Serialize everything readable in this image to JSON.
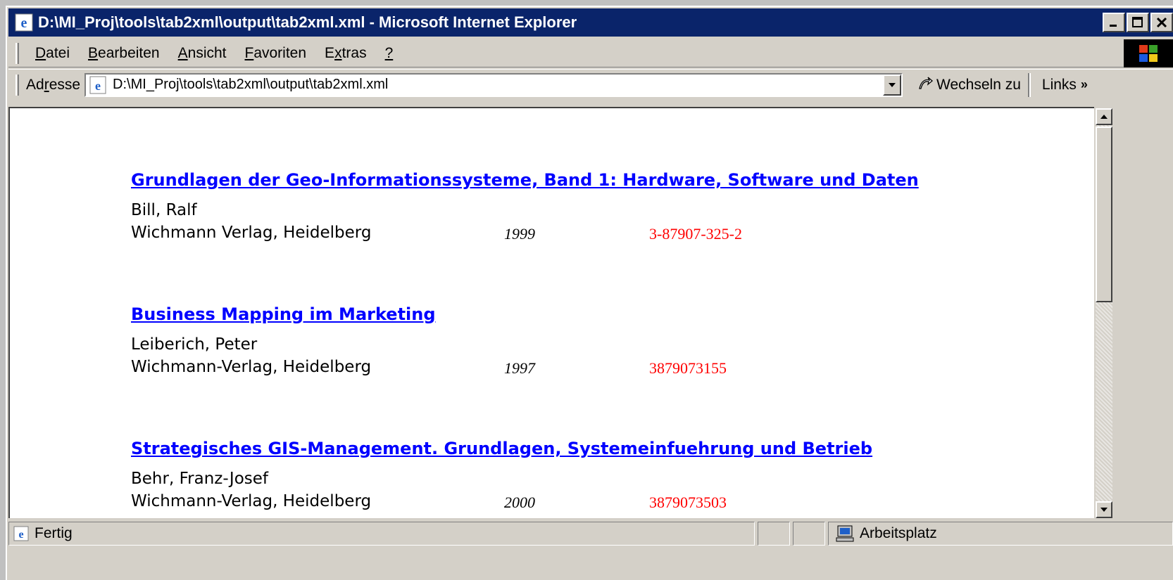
{
  "window": {
    "title": "D:\\MI_Proj\\tools\\tab2xml\\output\\tab2xml.xml - Microsoft Internet Explorer",
    "icon": "ie-icon"
  },
  "menu": {
    "items": [
      {
        "pre": "",
        "key": "D",
        "post": "atei"
      },
      {
        "pre": "",
        "key": "B",
        "post": "earbeiten"
      },
      {
        "pre": "",
        "key": "A",
        "post": "nsicht"
      },
      {
        "pre": "",
        "key": "F",
        "post": "avoriten"
      },
      {
        "pre": "E",
        "key": "x",
        "post": "tras"
      },
      {
        "pre": "",
        "key": "?",
        "post": ""
      }
    ]
  },
  "address": {
    "label_pre": "Ad",
    "label_key": "r",
    "label_post": "esse",
    "value": "D:\\MI_Proj\\tools\\tab2xml\\output\\tab2xml.xml",
    "go_label": "Wechseln zu",
    "links_label": "Links"
  },
  "entries": [
    {
      "title": "Grundlagen der Geo-Informationssysteme, Band 1: Hardware, Software und Daten",
      "author": "Bill, Ralf",
      "publisher": "Wichmann Verlag, Heidelberg",
      "year": "1999",
      "isbn": "3-87907-325-2"
    },
    {
      "title": "Business Mapping im Marketing",
      "author": "Leiberich, Peter",
      "publisher": "Wichmann-Verlag, Heidelberg",
      "year": "1997",
      "isbn": "3879073155"
    },
    {
      "title": "Strategisches GIS-Management. Grundlagen, Systemeinfuehrung und Betrieb",
      "author": "Behr, Franz-Josef",
      "publisher": "Wichmann-Verlag, Heidelberg",
      "year": "2000",
      "isbn": "3879073503"
    }
  ],
  "status": {
    "text": "Fertig",
    "zone": "Arbeitsplatz"
  },
  "colors": {
    "titlebar": "#0a246a",
    "link": "#0000ff",
    "isbn": "#ff0000",
    "chrome": "#d4d0c8"
  }
}
